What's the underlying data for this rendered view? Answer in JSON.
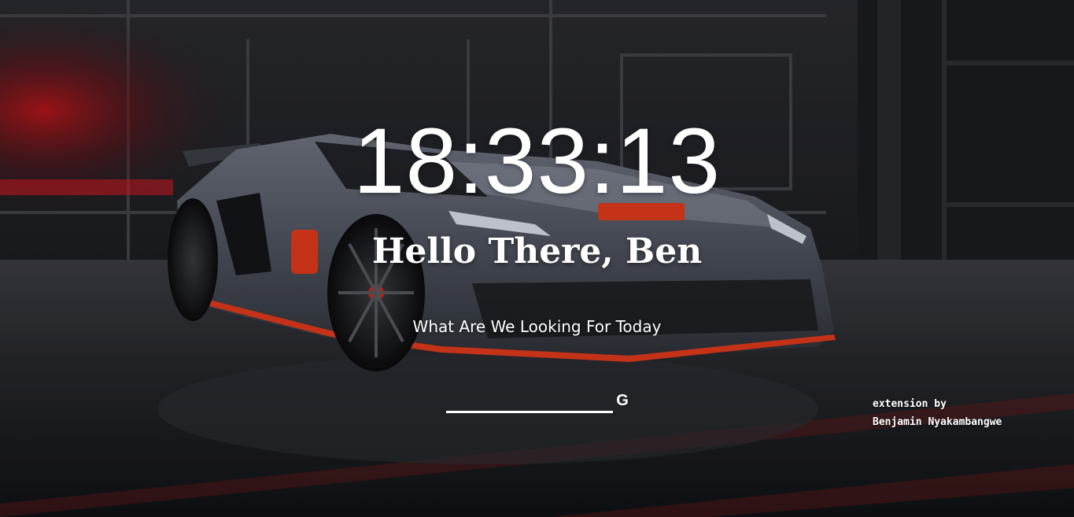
{
  "clock": {
    "time": "18:33:13"
  },
  "greeting": {
    "text": "Hello There, Ben"
  },
  "subtitle": {
    "text": "What Are We Looking For Today"
  },
  "search": {
    "placeholder": "",
    "value": "",
    "button_label": "G",
    "button_icon": "google-g-icon"
  },
  "credit": {
    "line1": "extension by",
    "line2": "Benjamin Nyakambangwe"
  },
  "background": {
    "subject": "dark grey supercar with orange accents in a dark garage",
    "accent_color": "#e0391c"
  }
}
